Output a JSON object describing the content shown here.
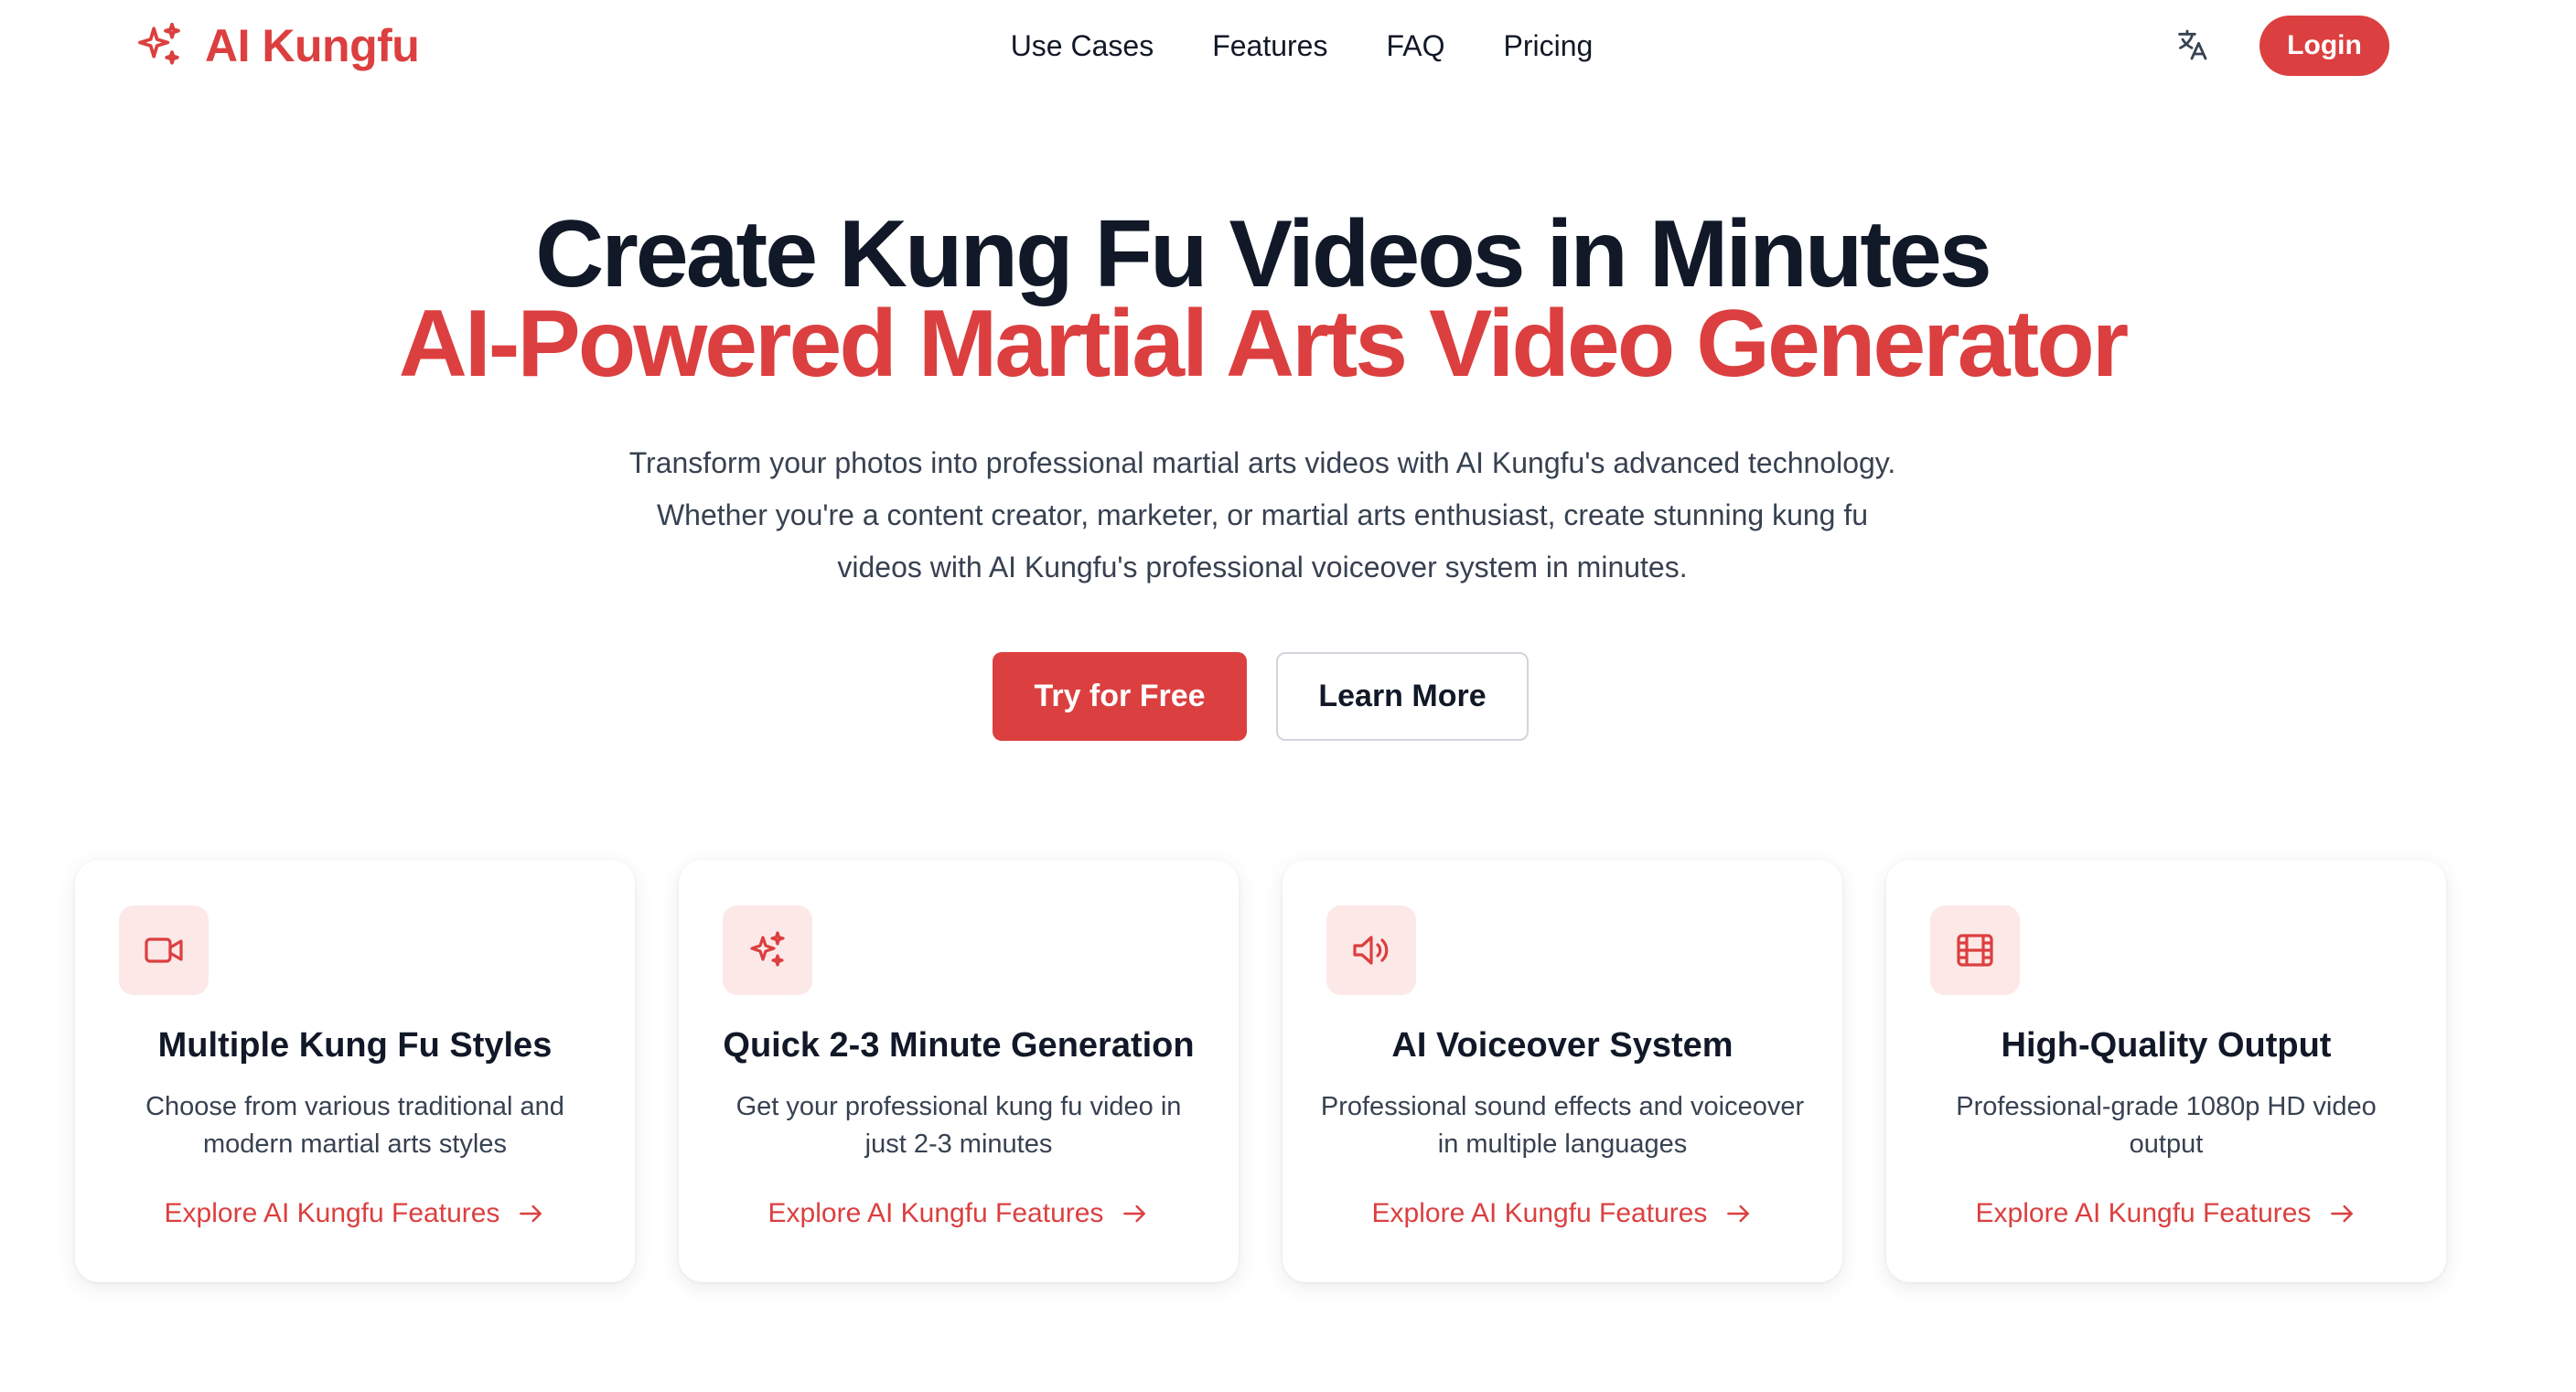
{
  "brand": {
    "name": "AI Kungfu",
    "icon": "sparkles-icon"
  },
  "nav": {
    "items": [
      {
        "label": "Use Cases"
      },
      {
        "label": "Features"
      },
      {
        "label": "FAQ"
      },
      {
        "label": "Pricing"
      }
    ]
  },
  "header": {
    "translate_icon": "translate-icon",
    "login_label": "Login"
  },
  "hero": {
    "title": "Create Kung Fu Videos in Minutes",
    "subtitle": "AI-Powered Martial Arts Video Generator",
    "description": "Transform your photos into professional martial arts videos with AI Kungfu's advanced technology. Whether you're a content creator, marketer, or martial arts enthusiast, create stunning kung fu videos with AI Kungfu's professional voiceover system in minutes.",
    "primary_cta": "Try for Free",
    "secondary_cta": "Learn More"
  },
  "features": [
    {
      "icon": "video-camera-icon",
      "title": "Multiple Kung Fu Styles",
      "description": "Choose from various traditional and modern martial arts styles",
      "link": "Explore AI Kungfu Features"
    },
    {
      "icon": "sparkles-icon",
      "title": "Quick 2-3 Minute Generation",
      "description": "Get your professional kung fu video in just 2-3 minutes",
      "link": "Explore AI Kungfu Features"
    },
    {
      "icon": "speaker-icon",
      "title": "AI Voiceover System",
      "description": "Professional sound effects and voiceover in multiple languages",
      "link": "Explore AI Kungfu Features"
    },
    {
      "icon": "film-icon",
      "title": "High-Quality Output",
      "description": "Professional-grade 1080p HD video output",
      "link": "Explore AI Kungfu Features"
    }
  ],
  "colors": {
    "accent": "#dc3f3f",
    "accent_soft": "#fde8e8",
    "text": "#111827",
    "muted": "#374151"
  }
}
